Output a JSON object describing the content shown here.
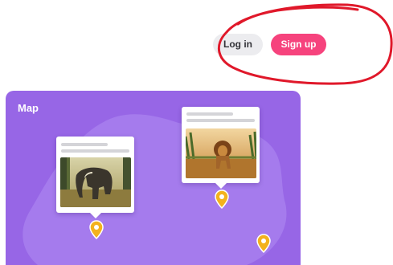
{
  "header": {
    "login_label": "Log in",
    "signup_label": "Sign up"
  },
  "map": {
    "title": "Map",
    "background_color": "#9766e6",
    "pin_color": "#f3b21d",
    "cards": [
      {
        "name": "elephant-card",
        "image": "elephant-photo"
      },
      {
        "name": "lion-card",
        "image": "lion-photo"
      }
    ],
    "pins": [
      "location-pin-icon",
      "location-pin-icon",
      "location-pin-icon"
    ]
  },
  "colors": {
    "signup": "#f6437d",
    "login_bg": "#ececef",
    "annotation": "#e0182a"
  }
}
